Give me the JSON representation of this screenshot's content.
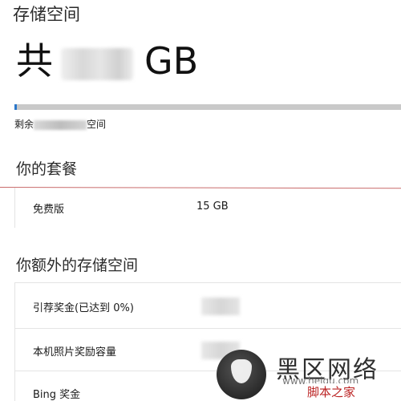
{
  "storage": {
    "title": "存储空间",
    "total_prefix": "共",
    "total_unit": "GB",
    "remaining_prefix": "剩余",
    "remaining_suffix": "空间",
    "usage_fraction": 0.006,
    "bar_color": "#2b77c9"
  },
  "plan": {
    "title": "你的套餐",
    "rows": [
      {
        "label": "免费版",
        "value": "15 GB"
      }
    ]
  },
  "extra": {
    "title": "你额外的存储空间",
    "rows": [
      {
        "label": "引荐奖金(已达到 0%)"
      },
      {
        "label": "本机照片奖励容量"
      },
      {
        "label": "Bing 奖金"
      }
    ]
  },
  "watermark": {
    "brand_part1": "黑区",
    "brand_part2": "网络",
    "domain": "www.heiqu.com",
    "sub": "脚本之家"
  }
}
